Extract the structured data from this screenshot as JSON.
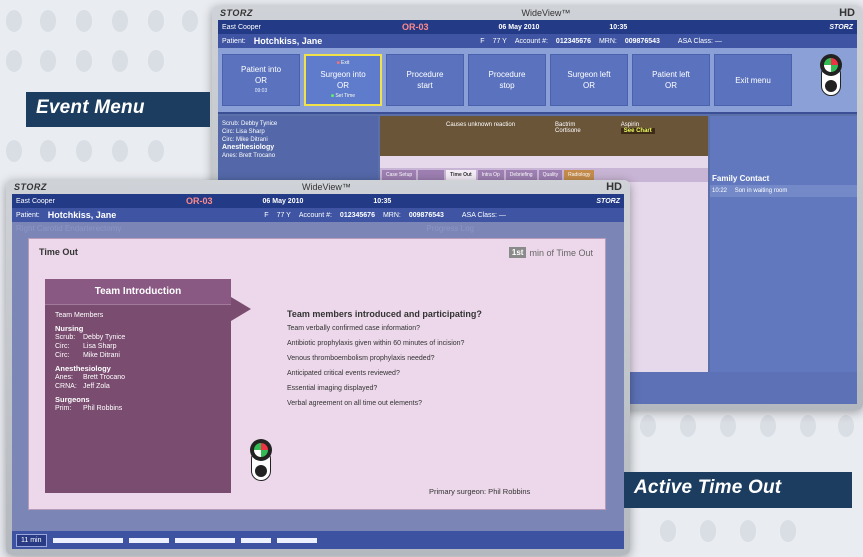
{
  "captions": {
    "event_menu": "Event Menu",
    "active_time_out": "Active Time Out"
  },
  "monitor_top": {
    "brand": "STORZ",
    "title": "WideView™",
    "hd": "HD",
    "topbar": {
      "org": "East Cooper",
      "or": "OR-03",
      "date": "06 May 2010",
      "time": "10:35",
      "brand": "STORZ"
    },
    "patient": {
      "label": "Patient:",
      "name": "Hotchkiss, Jane",
      "sex": "F",
      "age": "77 Y",
      "account_label": "Account #:",
      "account": "012345676",
      "mrn_label": "MRN:",
      "mrn": "009876543",
      "asa": "ASA Class: —"
    },
    "event_buttons": [
      {
        "label": "Patient into OR",
        "sub": "09:03"
      },
      {
        "label": "Surgeon into OR",
        "top": "Exit",
        "sub": "Set Time",
        "active": true
      },
      {
        "label": "Procedure start"
      },
      {
        "label": "Procedure stop"
      },
      {
        "label": "Surgeon left OR"
      },
      {
        "label": "Patient left OR"
      },
      {
        "label": "Exit menu"
      }
    ],
    "left_panel": {
      "scrub": "Scrub: Debby Tynice",
      "circ1": "Circ: Lisa Sharp",
      "circ2": "Circ: Mike Ditrani",
      "anesthesiology": "Anesthesiology",
      "anes": "Anes: Brett Trocano"
    },
    "reactions": {
      "text": "Causes unknown reaction",
      "drug1": "Bactrim",
      "drug2": "Cortisone",
      "drug3": "Aspirin",
      "see_chart": "See Chart"
    },
    "tabs": [
      "Case Setup",
      "",
      "Time Out",
      "Intra Op",
      "Debriefing",
      "Quality",
      "Radiology"
    ],
    "family_contact": {
      "title": "Family Contact",
      "time": "10:22",
      "text": "Son in waiting room"
    }
  },
  "monitor_bottom": {
    "brand": "STORZ",
    "title": "WideView™",
    "hd": "HD",
    "topbar": {
      "org": "East Cooper",
      "or": "OR-03",
      "date": "06 May 2010",
      "time": "10:35",
      "brand": "STORZ"
    },
    "patient": {
      "label": "Patient:",
      "name": "Hotchkiss, Jane",
      "sex": "F",
      "age": "77 Y",
      "account_label": "Account #:",
      "account": "012345676",
      "mrn_label": "MRN:",
      "mrn": "009876543",
      "asa": "ASA Class: —"
    },
    "ghost_left": "Right Carotid Endarterectomy",
    "ghost_right": "Progress Log",
    "time_out": {
      "title": "Time Out",
      "min_number": "1st",
      "min_label": "min of Time Out",
      "team": {
        "header": "Team Introduction",
        "members": "Team Members",
        "nursing": "Nursing",
        "scrub_role": "Scrub:",
        "scrub": "Debby Tynice",
        "circ_role": "Circ:",
        "circ1": "Lisa Sharp",
        "circ2": "Mike Ditrani",
        "anesthesiology": "Anesthesiology",
        "anes_role": "Anes:",
        "anes": "Brett Trocano",
        "crna_role": "CRNA:",
        "crna": "Jeff Zola",
        "surgeons": "Surgeons",
        "prim_role": "Prim:",
        "prim": "Phil Robbins"
      },
      "questions_title": "Team members introduced and participating?",
      "questions": [
        "Team verbally confirmed case information?",
        "Antibiotic prophylaxis given within 60 minutes of incision?",
        "Venous thromboembolism prophylaxis needed?",
        "Anticipated critical events reviewed?",
        "Essential imaging displayed?",
        "Verbal agreement on all time out elements?"
      ],
      "primary_surgeon": "Primary surgeon: Phil Robbins"
    },
    "elapsed": "11 min"
  }
}
